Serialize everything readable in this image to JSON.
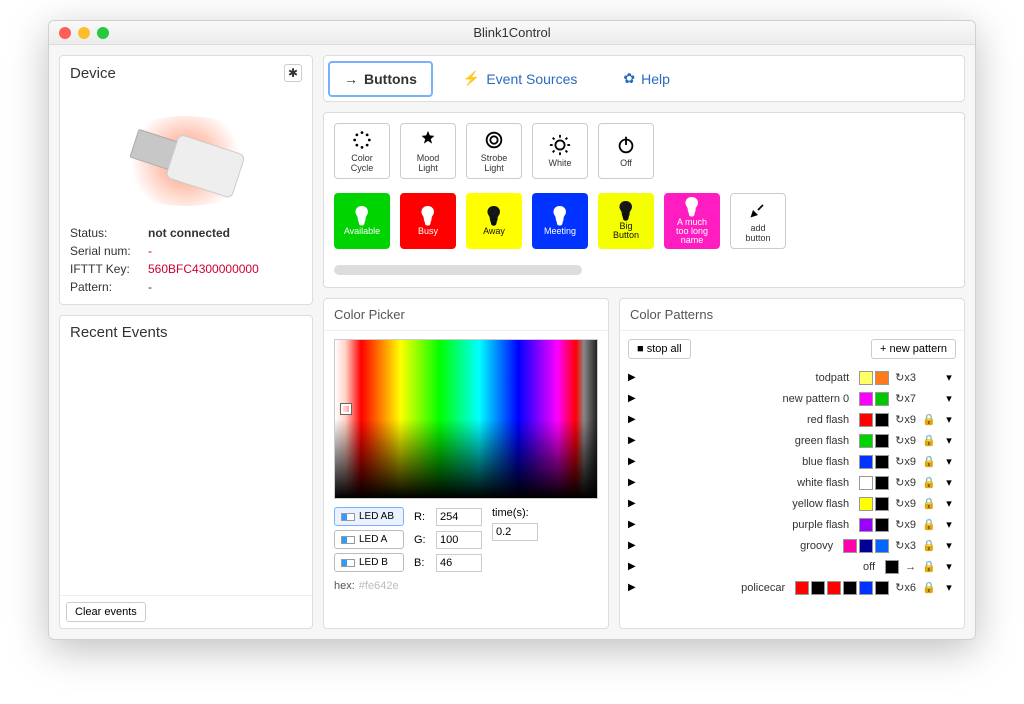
{
  "window_title": "Blink1Control",
  "tabs": {
    "buttons": "Buttons",
    "events": "Event Sources",
    "help": "Help"
  },
  "device": {
    "title": "Device",
    "rows": [
      {
        "label": "Status:",
        "value": "not connected",
        "style": "bold"
      },
      {
        "label": "Serial num:",
        "value": "-",
        "style": "red"
      },
      {
        "label": "IFTTT Key:",
        "value": "560BFC4300000000",
        "style": "red"
      },
      {
        "label": "Pattern:",
        "value": "-",
        "style": ""
      }
    ]
  },
  "recent_events": {
    "title": "Recent Events",
    "clear_label": "Clear events"
  },
  "mode_buttons": [
    {
      "label": "Color\nCycle",
      "icon": "cycle"
    },
    {
      "label": "Mood\nLight",
      "icon": "mood"
    },
    {
      "label": "Strobe\nLight",
      "icon": "strobe"
    },
    {
      "label": "White",
      "icon": "white"
    },
    {
      "label": "Off",
      "icon": "power"
    }
  ],
  "color_buttons": [
    {
      "label": "Available",
      "bg": "#00d400",
      "fg": "#ffffff"
    },
    {
      "label": "Busy",
      "bg": "#ff0000",
      "fg": "#ffffff"
    },
    {
      "label": "Away",
      "bg": "#ffff00",
      "fg": "#111111"
    },
    {
      "label": "Meeting",
      "bg": "#0033ff",
      "fg": "#ffffff"
    },
    {
      "label": "Big\nButton",
      "bg": "#f6ff00",
      "fg": "#111111"
    },
    {
      "label": "A much\ntoo long\nname",
      "bg": "#ff1dc1",
      "fg": "#ffffff"
    }
  ],
  "add_button_label": "add\nbutton",
  "color_picker": {
    "title": "Color Picker",
    "led_buttons": [
      "LED AB",
      "LED A",
      "LED B"
    ],
    "r_label": "R:",
    "g_label": "G:",
    "b_label": "B:",
    "r": "254",
    "g": "100",
    "b": "46",
    "time_label": "time(s):",
    "time": "0.2",
    "hex_label": "hex:",
    "hex": "#fe642e"
  },
  "color_patterns": {
    "title": "Color Patterns",
    "stop_all": "stop all",
    "new_pattern": "new pattern",
    "rows": [
      {
        "name": "todpatt",
        "swatches": [
          "#ffff66",
          "#ff7a1a"
        ],
        "loop": "x3",
        "locked": false
      },
      {
        "name": "new pattern 0",
        "swatches": [
          "#ff00ff",
          "#00c800"
        ],
        "loop": "x7",
        "locked": false
      },
      {
        "name": "red flash",
        "swatches": [
          "#ff0000",
          "#000000"
        ],
        "loop": "x9",
        "locked": true
      },
      {
        "name": "green flash",
        "swatches": [
          "#00d400",
          "#000000"
        ],
        "loop": "x9",
        "locked": true
      },
      {
        "name": "blue flash",
        "swatches": [
          "#0033ff",
          "#000000"
        ],
        "loop": "x9",
        "locked": true
      },
      {
        "name": "white flash",
        "swatches": [
          "#ffffff",
          "#000000"
        ],
        "loop": "x9",
        "locked": true
      },
      {
        "name": "yellow flash",
        "swatches": [
          "#ffff00",
          "#000000"
        ],
        "loop": "x9",
        "locked": true
      },
      {
        "name": "purple flash",
        "swatches": [
          "#9900ff",
          "#000000"
        ],
        "loop": "x9",
        "locked": true
      },
      {
        "name": "groovy",
        "swatches": [
          "#ff00aa",
          "#000099",
          "#0066ff"
        ],
        "loop": "x3",
        "locked": true
      },
      {
        "name": "off",
        "swatches": [
          "#000000"
        ],
        "loop": "→",
        "locked": true
      },
      {
        "name": "policecar",
        "swatches": [
          "#ff0000",
          "#000000",
          "#ff0000",
          "#000000",
          "#0033ff",
          "#000000"
        ],
        "loop": "x6",
        "locked": true
      }
    ]
  }
}
